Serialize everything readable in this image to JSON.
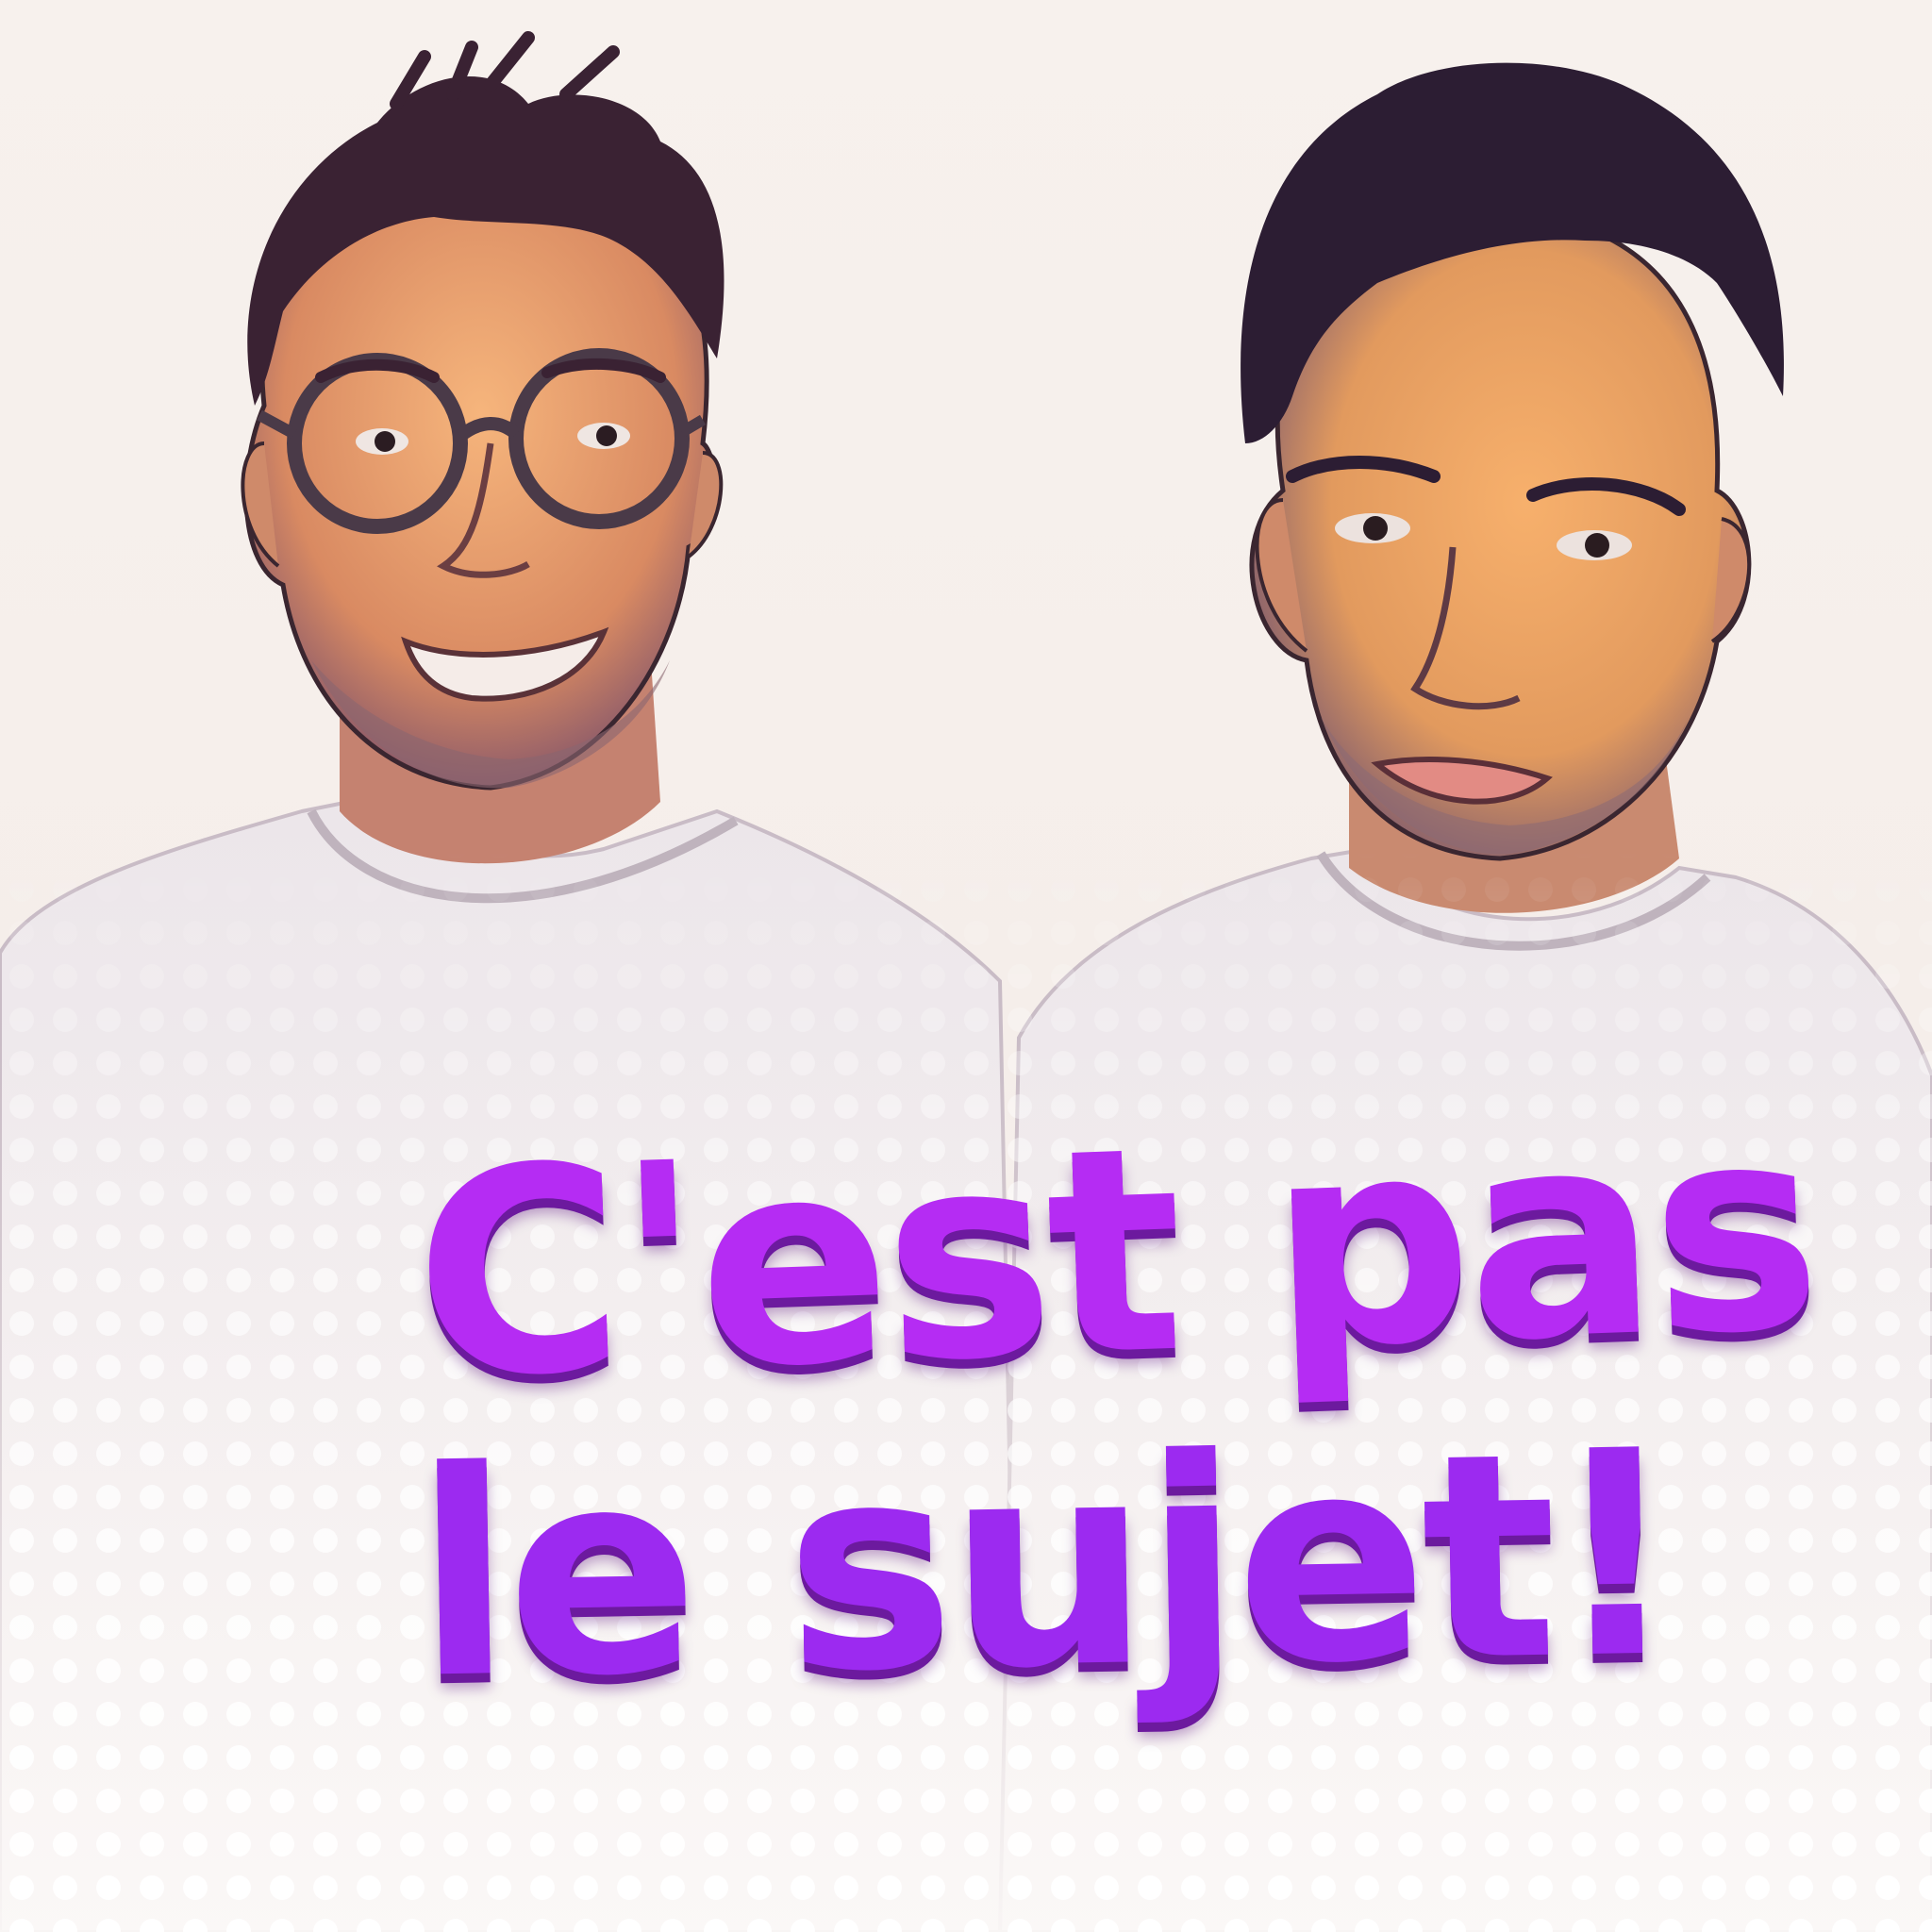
{
  "podcast": {
    "title_line_1": "C'est pas",
    "title_line_2": "le sujet!"
  },
  "hosts": [
    {
      "icon": "host-with-glasses-portrait"
    },
    {
      "icon": "host-portrait"
    }
  ],
  "colors": {
    "title": "#b52cf3",
    "title_shadow": "#6c1a9e",
    "background": "#f5f0ec",
    "dots": "#ffffff",
    "skin": "#e8a070",
    "hair": "#2e1e33",
    "shirt": "#ece8ea"
  }
}
